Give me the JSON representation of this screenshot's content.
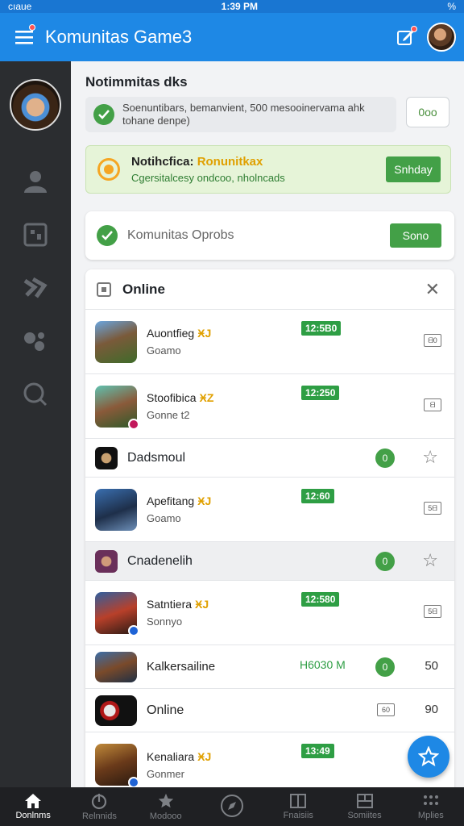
{
  "status_bar": {
    "left": "cıaue",
    "time": "1:39 PM",
    "right": "%"
  },
  "app_bar": {
    "title": "Komunitas Game3"
  },
  "section": {
    "title": "Notimmitas dks",
    "notice_text": "Soenuntibars, bemanvient, 500 mesooinervama ahk tohane denpe)",
    "count_label": "0oo"
  },
  "promo": {
    "title_plain": "Notihcfica:",
    "title_accent": "Ronunitkax",
    "subtitle": "Cgersitalcesy ondcoo, nholncads",
    "button": "Snhday"
  },
  "search": {
    "placeholder": "Komunitas Oprobs",
    "button": "Sono"
  },
  "list": {
    "header": "Online",
    "rows": [
      {
        "kind": "game",
        "name": "Auontfieg",
        "tag": "ӾJ",
        "sub": "Goamo",
        "time": "12:5B0",
        "right": "ᗺ0"
      },
      {
        "kind": "game",
        "name": "Stoofibica",
        "tag": "ӾZ",
        "sub": "Gonne t2",
        "time": "12:250",
        "right": "ᗺ"
      },
      {
        "kind": "group",
        "name": "Dadsmoul",
        "dot": "0"
      },
      {
        "kind": "game",
        "name": "Apefitang",
        "tag": "ӾJ",
        "sub": "Goamo",
        "time": "12:60",
        "right": "5ᗺ"
      },
      {
        "kind": "group",
        "name": "Cnadenelih",
        "dot": "0",
        "shaded": true
      },
      {
        "kind": "game",
        "name": "Satntiera",
        "tag": "ӾJ",
        "sub": "Sonnyo",
        "time": "12:580",
        "right": "5ᗺ"
      },
      {
        "kind": "mini",
        "name": "Kalkersailine",
        "time_text": "H6030 M",
        "dot": "0",
        "right": "50"
      },
      {
        "kind": "mini",
        "name": "Online",
        "boxed": "60",
        "right": "90"
      },
      {
        "kind": "game",
        "name": "Kenaliara",
        "tag": "ӾJ",
        "sub": "Gonmer",
        "time": "13:49",
        "right": ""
      }
    ]
  },
  "bottom_nav": [
    {
      "label": "Donlnms",
      "icon": "home-icon",
      "active": true
    },
    {
      "label": "Relnnids",
      "icon": "power-icon"
    },
    {
      "label": "Modooo",
      "icon": "star-icon"
    },
    {
      "label": "",
      "icon": "compass-icon"
    },
    {
      "label": "Fnaisiis",
      "icon": "book-icon"
    },
    {
      "label": "Somiites",
      "icon": "panel-icon"
    },
    {
      "label": "Mplies",
      "icon": "grid-icon"
    }
  ],
  "colors": {
    "primary": "#1e88e5",
    "green": "#43a047",
    "accent": "#e0a000",
    "sidebar": "#2b2d30"
  }
}
